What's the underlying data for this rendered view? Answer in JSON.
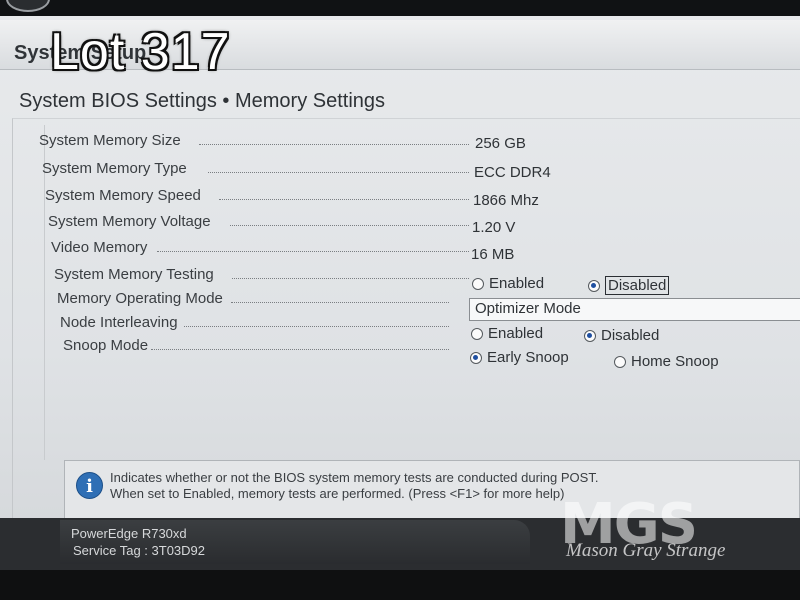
{
  "overlay": {
    "lot": "Lot 317"
  },
  "header": {
    "system_title": "System Setup",
    "page_title": "System BIOS Settings • Memory Settings"
  },
  "settings": {
    "memory_size": {
      "label": "System Memory Size",
      "value": "256 GB"
    },
    "memory_type": {
      "label": "System Memory Type",
      "value": "ECC DDR4"
    },
    "memory_speed": {
      "label": "System Memory Speed",
      "value": "1866 Mhz"
    },
    "memory_voltage": {
      "label": "System Memory Voltage",
      "value": "1.20 V"
    },
    "video_memory": {
      "label": "Video Memory",
      "value": "16 MB"
    },
    "memory_testing": {
      "label": "System Memory Testing",
      "options": [
        "Enabled",
        "Disabled"
      ],
      "selected": "Disabled"
    },
    "operating_mode": {
      "label": "Memory Operating Mode",
      "value": "Optimizer Mode"
    },
    "node_interleaving": {
      "label": "Node Interleaving",
      "options": [
        "Enabled",
        "Disabled"
      ],
      "selected": "Disabled"
    },
    "snoop_mode": {
      "label": "Snoop Mode",
      "options": [
        "Early Snoop",
        "Home Snoop"
      ],
      "selected": "Early Snoop"
    }
  },
  "help": {
    "line1": "Indicates whether or not the BIOS system memory tests are conducted during POST.",
    "line2": "When set to Enabled, memory tests are performed. (Press <F1> for more help)"
  },
  "footer": {
    "model": "PowerEdge R730xd",
    "service_tag": "Service Tag : 3T03D92"
  },
  "watermark": {
    "logo": "MGS",
    "name": "Mason Gray Strange"
  },
  "colors": {
    "accent": "#1f4fa0",
    "info_icon": "#2f6fb5",
    "footer": "#2b2d30"
  },
  "icons": {
    "info": "info-icon"
  }
}
